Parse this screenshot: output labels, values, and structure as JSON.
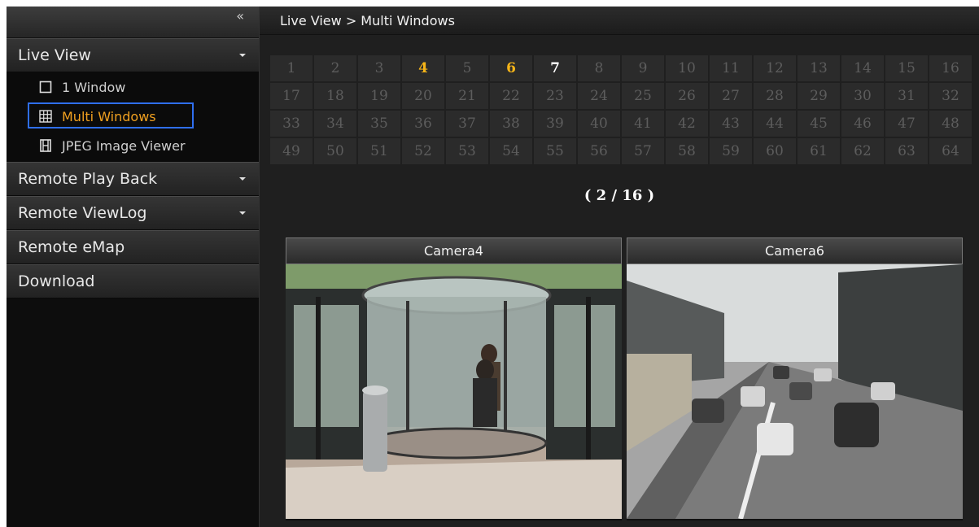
{
  "sidebar": {
    "collapse_glyph": "«",
    "sections": [
      {
        "label": "Live View",
        "expanded": true
      },
      {
        "label": "Remote Play Back",
        "expanded": false
      },
      {
        "label": "Remote ViewLog",
        "expanded": false
      },
      {
        "label": "Remote eMap"
      },
      {
        "label": "Download"
      }
    ],
    "live_view_items": [
      {
        "label": "1 Window",
        "icon": "square-icon"
      },
      {
        "label": "Multi Windows",
        "icon": "grid-icon",
        "active": true
      },
      {
        "label": "JPEG Image Viewer",
        "icon": "film-icon"
      }
    ]
  },
  "breadcrumb": "Live View > Multi Windows",
  "channels": {
    "numbers": [
      "1",
      "2",
      "3",
      "4",
      "5",
      "6",
      "7",
      "8",
      "9",
      "10",
      "11",
      "12",
      "13",
      "14",
      "15",
      "16",
      "17",
      "18",
      "19",
      "20",
      "21",
      "22",
      "23",
      "24",
      "25",
      "26",
      "27",
      "28",
      "29",
      "30",
      "31",
      "32",
      "33",
      "34",
      "35",
      "36",
      "37",
      "38",
      "39",
      "40",
      "41",
      "42",
      "43",
      "44",
      "45",
      "46",
      "47",
      "48",
      "49",
      "50",
      "51",
      "52",
      "53",
      "54",
      "55",
      "56",
      "57",
      "58",
      "59",
      "60",
      "61",
      "62",
      "63",
      "64"
    ],
    "highlight_yellow": [
      "4",
      "6"
    ],
    "highlight_white": [
      "7"
    ]
  },
  "pager": "( 2 / 16 )",
  "cameras": [
    {
      "title": "Camera4"
    },
    {
      "title": "Camera6"
    }
  ],
  "colors": {
    "accent_yellow": "#f5b418",
    "selection_blue": "#2f6ff0",
    "panel_dark": "#1f1f1f"
  }
}
